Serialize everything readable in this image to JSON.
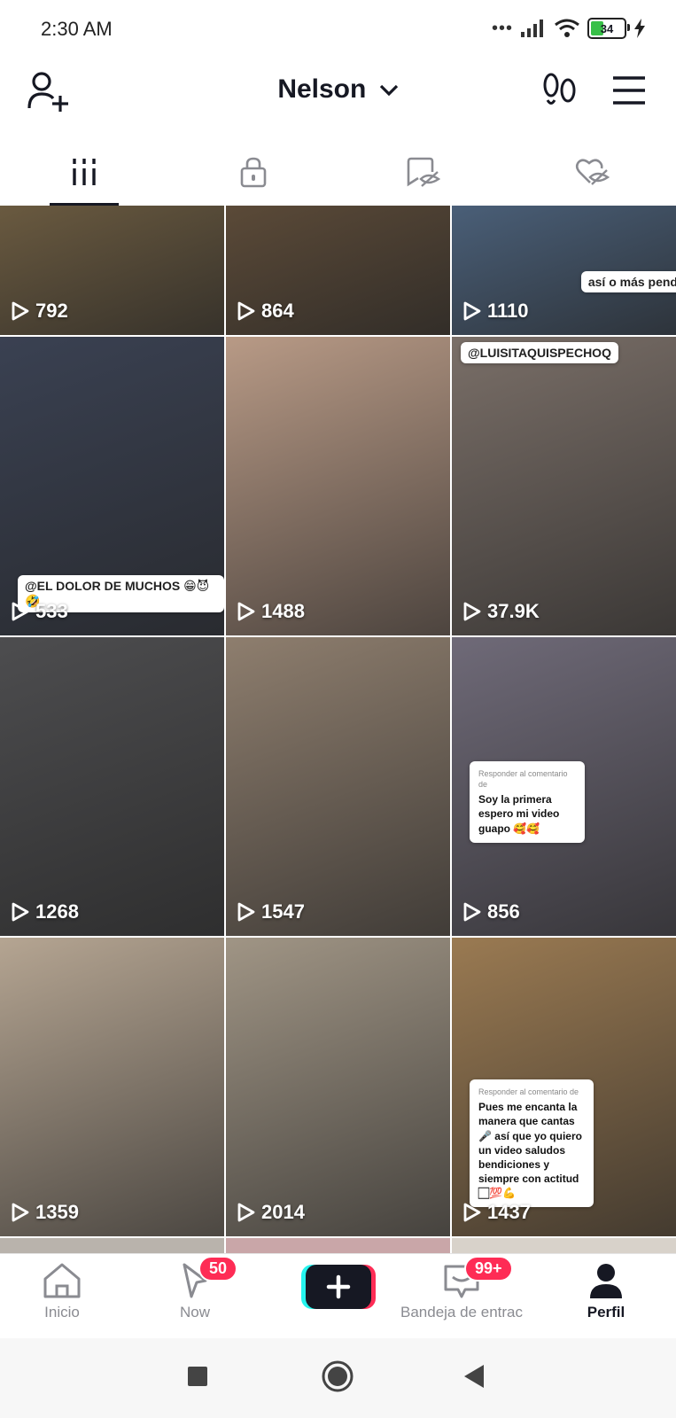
{
  "status_bar": {
    "time": "2:30 AM",
    "battery": "34",
    "icons": [
      "dots-icon",
      "signal-icon",
      "wifi-icon",
      "battery-icon",
      "charging-icon"
    ]
  },
  "header": {
    "username": "Nelson",
    "icons": [
      "add-user-icon",
      "footprint-icon",
      "menu-icon"
    ]
  },
  "tabs": [
    {
      "name": "videos",
      "icon": "grid-icon",
      "active": true
    },
    {
      "name": "private",
      "icon": "lock-icon",
      "active": false
    },
    {
      "name": "favorites",
      "icon": "bookmark-hidden-icon",
      "active": false
    },
    {
      "name": "liked",
      "icon": "heart-hidden-icon",
      "active": false
    }
  ],
  "videos": [
    {
      "views": "792",
      "color": "#6a5a40"
    },
    {
      "views": "864",
      "color": "#5b4a38"
    },
    {
      "views": "1110",
      "color": "#4a5f78",
      "caption": "así o más pend"
    },
    {
      "views": "533",
      "color": "#3a4152",
      "tag": "@EL DOLOR DE MUCHOS 😁😈🤣"
    },
    {
      "views": "1488",
      "color": "#b89a86"
    },
    {
      "views": "37.9K",
      "color": "#7a6f68",
      "tag": "@LUISITAQUISPECHOQ"
    },
    {
      "views": "1268",
      "color": "#4d4d4f"
    },
    {
      "views": "1547",
      "color": "#8e7e6e"
    },
    {
      "views": "856",
      "color": "#6f6a78",
      "comment_sub": "Responder al comentario de",
      "comment": "Soy la primera espero mi video guapo 🥰🥰"
    },
    {
      "views": "1359",
      "color": "#b5a592"
    },
    {
      "views": "2014",
      "color": "#a09585"
    },
    {
      "views": "1437",
      "color": "#9a7a52",
      "comment_sub": "Responder al comentario de",
      "comment": "Pues me encanta la manera que cantas 🎤 así que yo quiero un video saludos bendiciones y siempre con actitud 🏻💯💪"
    }
  ],
  "bottom_nav": {
    "items": [
      {
        "label": "Inicio",
        "icon": "home-icon"
      },
      {
        "label": "Now",
        "icon": "now-icon",
        "badge": "50"
      },
      {
        "label": "",
        "icon": "plus-icon"
      },
      {
        "label": "Bandeja de entrac",
        "icon": "inbox-icon",
        "badge": "99+"
      },
      {
        "label": "Perfil",
        "icon": "profile-icon"
      }
    ]
  },
  "system_nav": {
    "icons": [
      "recents-icon",
      "home-circle-icon",
      "back-icon"
    ]
  },
  "colors": {
    "accent": "#fe2c55",
    "text": "#161823",
    "muted": "#8a8b91"
  }
}
